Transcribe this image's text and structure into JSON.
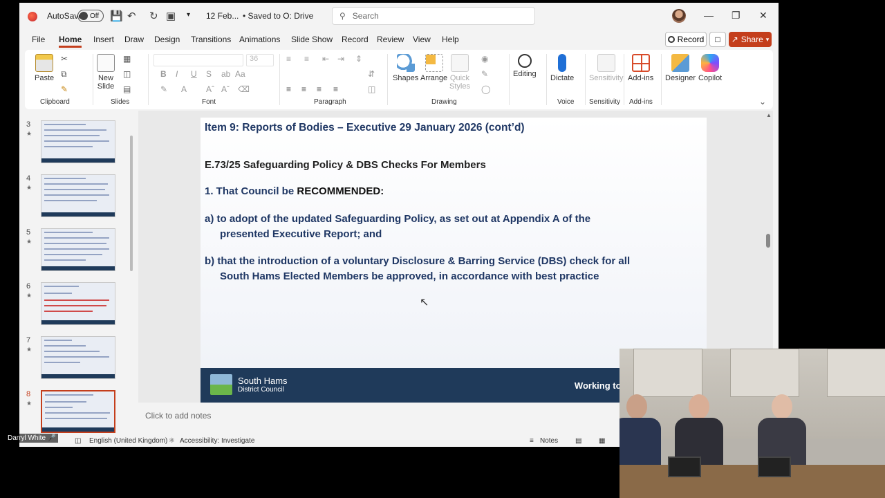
{
  "titlebar": {
    "autosave_label": "AutoSave",
    "autosave_state": "Off",
    "filename": "12 Feb...",
    "saved_status": "• Saved to O: Drive",
    "search_placeholder": "Search"
  },
  "menu": {
    "tabs": [
      "File",
      "Home",
      "Insert",
      "Draw",
      "Design",
      "Transitions",
      "Animations",
      "Slide Show",
      "Record",
      "Review",
      "View",
      "Help"
    ],
    "active": "Home",
    "record_label": "Record",
    "share_label": "Share"
  },
  "ribbon": {
    "paste": "Paste",
    "new_slide_1": "New",
    "new_slide_2": "Slide",
    "font_size": "36",
    "shapes": "Shapes",
    "arrange": "Arrange",
    "quick_styles_1": "Quick",
    "quick_styles_2": "Styles",
    "editing": "Editing",
    "dictate": "Dictate",
    "sensitivity": "Sensitivity",
    "addins": "Add-ins",
    "designer": "Designer",
    "copilot": "Copilot",
    "groups": {
      "clipboard": "Clipboard",
      "slides": "Slides",
      "font": "Font",
      "paragraph": "Paragraph",
      "drawing": "Drawing",
      "voice": "Voice",
      "sensitivity": "Sensitivity",
      "addins": "Add-ins"
    },
    "accent_color": "#c43e1c"
  },
  "thumbnails": [
    {
      "num": "3"
    },
    {
      "num": "4"
    },
    {
      "num": "5"
    },
    {
      "num": "6"
    },
    {
      "num": "7"
    },
    {
      "num": "8"
    }
  ],
  "slide": {
    "title": "Item 9: Reports of Bodies – Executive 29 January 2026 (cont’d)",
    "subtitle": "E.73/25 Safeguarding Policy & DBS Checks For Members",
    "rec_prefix": "1. That Council be ",
    "rec_word": "RECOMMENDED:",
    "para_a_1": "a) to adopt of the updated Safeguarding Policy, as set out at Appendix A of the",
    "para_a_2": "presented Executive Report; and",
    "para_b_1": "b) that the introduction of a voluntary Disclosure & Barring Service (DBS) check for all",
    "para_b_2": "South Hams Elected Members be approved, in accordance with best practice",
    "footer_org_1": "South Hams",
    "footer_org_2": "District Council",
    "footer_tagline": "Working togeth"
  },
  "notes_placeholder": "Click to add notes",
  "statusbar": {
    "language": "English (United Kingdom)",
    "accessibility": "Accessibility: Investigate",
    "notes": "Notes"
  },
  "webcam": {
    "speaker": "Darryl White"
  }
}
